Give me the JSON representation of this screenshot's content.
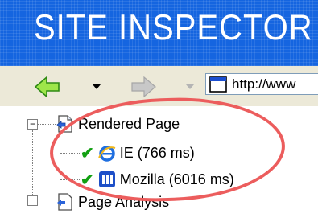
{
  "banner": {
    "title": "SITE INSPECTOR"
  },
  "toolbar": {
    "back_icon": "green-left-arrow-icon",
    "forward_icon": "gray-right-arrow-icon",
    "address_value": "http://www"
  },
  "tree": {
    "root": {
      "label": "Rendered Page",
      "expander": "−",
      "icon": "page-icon"
    },
    "children": [
      {
        "label": "IE (766 ms)",
        "status_icon": "checkmark-icon",
        "icon": "ie-icon"
      },
      {
        "label": "Mozilla (6016 ms)",
        "status_icon": "checkmark-icon",
        "icon": "mozilla-icon"
      }
    ],
    "next_root": {
      "label": "Page Analysis"
    }
  },
  "colors": {
    "banner": "#1565e0",
    "highlight": "#ec5d5d",
    "check": "#12a012"
  }
}
